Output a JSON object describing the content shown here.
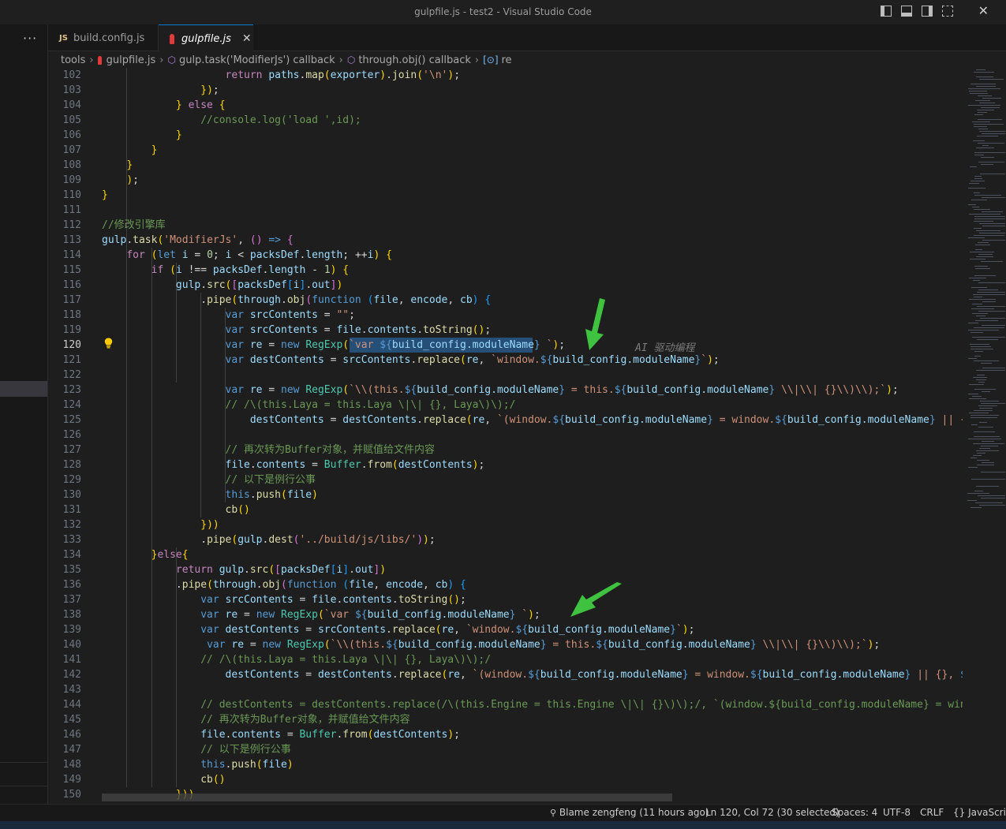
{
  "window": {
    "title": "gulpfile.js - test2 - Visual Studio Code"
  },
  "sidebar": {
    "more_label": "···"
  },
  "tabs": [
    {
      "icon": "JS",
      "label": "build.config.js",
      "active": false
    },
    {
      "icon": "gulp-icon",
      "label": "gulpfile.js",
      "active": true,
      "close": "✕"
    }
  ],
  "breadcrumb": [
    {
      "label": "tools",
      "icon": ""
    },
    {
      "label": "gulpfile.js",
      "icon": "gulp-icon"
    },
    {
      "label": "gulp.task('ModifierJs') callback",
      "icon": "cube-icon"
    },
    {
      "label": "through.obj() callback",
      "icon": "cube-icon"
    },
    {
      "label": "re",
      "icon": "variable-icon"
    }
  ],
  "editor": {
    "first_line": 102,
    "active_line": 120,
    "ghost_text": "AI  驱动编程",
    "lines": [
      "                    return paths.map(exporter).join('\\n');",
      "                });",
      "            } else {",
      "                //console.log('load ',id);",
      "            }",
      "        }",
      "    }",
      "    );",
      "}",
      "",
      "//修改引擎库",
      "gulp.task('ModifierJs', () => {",
      "    for (let i = 0; i < packsDef.length; ++i) {",
      "        if (i !== packsDef.length - 1) {",
      "            gulp.src([packsDef[i].out])",
      "                .pipe(through.obj(function (file, encode, cb) {",
      "                    var srcContents = \"\";",
      "                    var srcContents = file.contents.toString();",
      "                    var re = new RegExp(`var ${build_config.moduleName} `);",
      "                    var destContents = srcContents.replace(re, `window.${build_config.moduleName}`);",
      "",
      "                    var re = new RegExp(`\\\\(this.${build_config.moduleName} = this.${build_config.moduleName} \\\\|\\\\| {}\\\\)\\\\);`);",
      "                    // /\\(this.Laya = this.Laya \\|\\| {}, Laya\\)\\);/",
      "                        destContents = destContents.replace(re, `(window.${build_config.moduleName} = window.${build_config.moduleName} || {},",
      "",
      "                    // 再次转为Buffer对象，并赋值给文件内容",
      "                    file.contents = Buffer.from(destContents);",
      "                    // 以下是例行公事",
      "                    this.push(file)",
      "                    cb()",
      "                }))",
      "                .pipe(gulp.dest('../build/js/libs/'));",
      "        }else{",
      "            return gulp.src([packsDef[i].out])",
      "            .pipe(through.obj(function (file, encode, cb) {",
      "                var srcContents = file.contents.toString();",
      "                var re = new RegExp(`var ${build_config.moduleName} `);",
      "                var destContents = srcContents.replace(re, `window.${build_config.moduleName}`);",
      "                 var re = new RegExp(`\\\\(this.${build_config.moduleName} = this.${build_config.moduleName} \\\\|\\\\| {}\\\\)\\\\);`);",
      "                // /\\(this.Laya = this.Laya \\|\\| {}, Laya\\)\\);/",
      "                    destContents = destContents.replace(re, `(window.${build_config.moduleName} = window.${build_config.moduleName} || {}, ${b",
      "",
      "                // destContents = destContents.replace(/\\(this.Engine = this.Engine \\|\\| {}\\)\\);/, `(window.${build_config.moduleName} = windo",
      "                // 再次转为Buffer对象，并赋值给文件内容",
      "                file.contents = Buffer.from(destContents);",
      "                // 以下是例行公事",
      "                this.push(file)",
      "                cb()",
      "            }))"
    ]
  },
  "statusbar": {
    "blame": "Blame zengfeng (11 hours ago)",
    "position": "Ln 120, Col 72 (30 selected)",
    "spaces": "Spaces: 4",
    "encoding": "UTF-8",
    "eol": "CRLF",
    "language_icon": "{}",
    "language": "JavaScript"
  },
  "colors": {
    "keyword": "#569cd6",
    "control": "#c586c0",
    "variable": "#9cdcfe",
    "function": "#dcdcaa",
    "string": "#ce9178",
    "comment": "#6a9955",
    "type": "#4ec9b0",
    "number": "#b5cea8",
    "arrow": "#3fc23f",
    "selection": "#264f78"
  }
}
